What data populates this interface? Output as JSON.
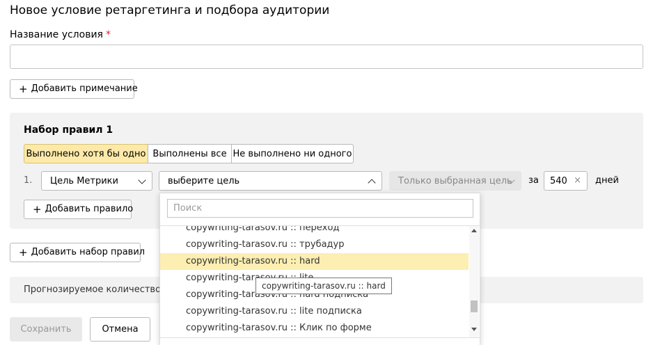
{
  "page": {
    "title": "Новое условие ретаргетинга и подбора аудитории"
  },
  "name_field": {
    "label": "Название условия",
    "required_mark": "*",
    "value": ""
  },
  "buttons": {
    "add_note": "Добавить примечание",
    "add_rule": "Добавить правило",
    "add_ruleset": "Добавить набор правил",
    "save": "Сохранить",
    "cancel": "Отмена",
    "plus": "+"
  },
  "ruleset": {
    "title": "Набор правил 1",
    "modes": [
      {
        "label": "Выполнено хотя бы одно",
        "selected": true
      },
      {
        "label": "Выполнены все",
        "selected": false
      },
      {
        "label": "Не выполнено ни одного",
        "selected": false
      }
    ],
    "rule": {
      "number": "1.",
      "type": "Цель Метрики",
      "goal_placeholder": "выберите цель",
      "scope": "Только выбранная цель",
      "for_label": "за",
      "days_value": "540",
      "clear_icon": "×",
      "days_label": "дней"
    }
  },
  "forecast": {
    "text": "Прогнозируемое количество по"
  },
  "dropdown": {
    "search_placeholder": "Поиск",
    "items": [
      "copywriting-tarasov.ru :: переход",
      "copywriting-tarasov.ru :: трубадур",
      "copywriting-tarasov.ru :: hard",
      "copywriting-tarasov.ru :: lite",
      "copywriting-tarasov.ru :: hard подписка",
      "copywriting-tarasov.ru :: lite подписка",
      "copywriting-tarasov.ru :: Клик по форме"
    ],
    "highlighted_index": 2,
    "tooltip": "copywriting-tarasov.ru :: hard"
  },
  "colors": {
    "accent_selected": "#fde9a9",
    "required": "#e0263a",
    "panel_bg": "#f2f2f2"
  }
}
